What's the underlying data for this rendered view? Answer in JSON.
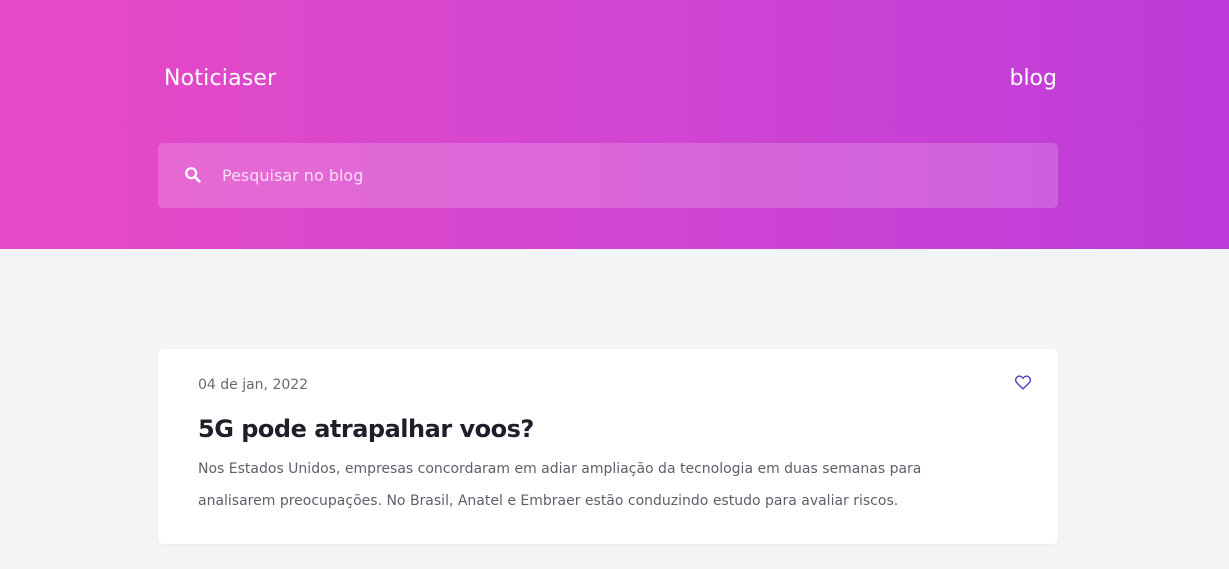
{
  "header": {
    "brand": "Noticiaser",
    "nav_link": "blog"
  },
  "search": {
    "placeholder": "Pesquisar no blog",
    "value": "",
    "icon": "search-icon"
  },
  "posts": [
    {
      "date": "04 de jan, 2022",
      "title": "5G pode atrapalhar voos?",
      "excerpt": "Nos Estados Unidos, empresas concordaram em adiar ampliação da tecnologia em duas semanas para analisarem preocupações. No Brasil, Anatel e Embraer estão conduzindo estudo para avaliar riscos.",
      "favorite_icon": "heart-icon"
    }
  ],
  "colors": {
    "hero_gradient_start": "#e74ac6",
    "hero_gradient_end": "#bd3bd9",
    "page_background": "#f3f4f6",
    "heart_stroke": "#5b3fc4"
  }
}
